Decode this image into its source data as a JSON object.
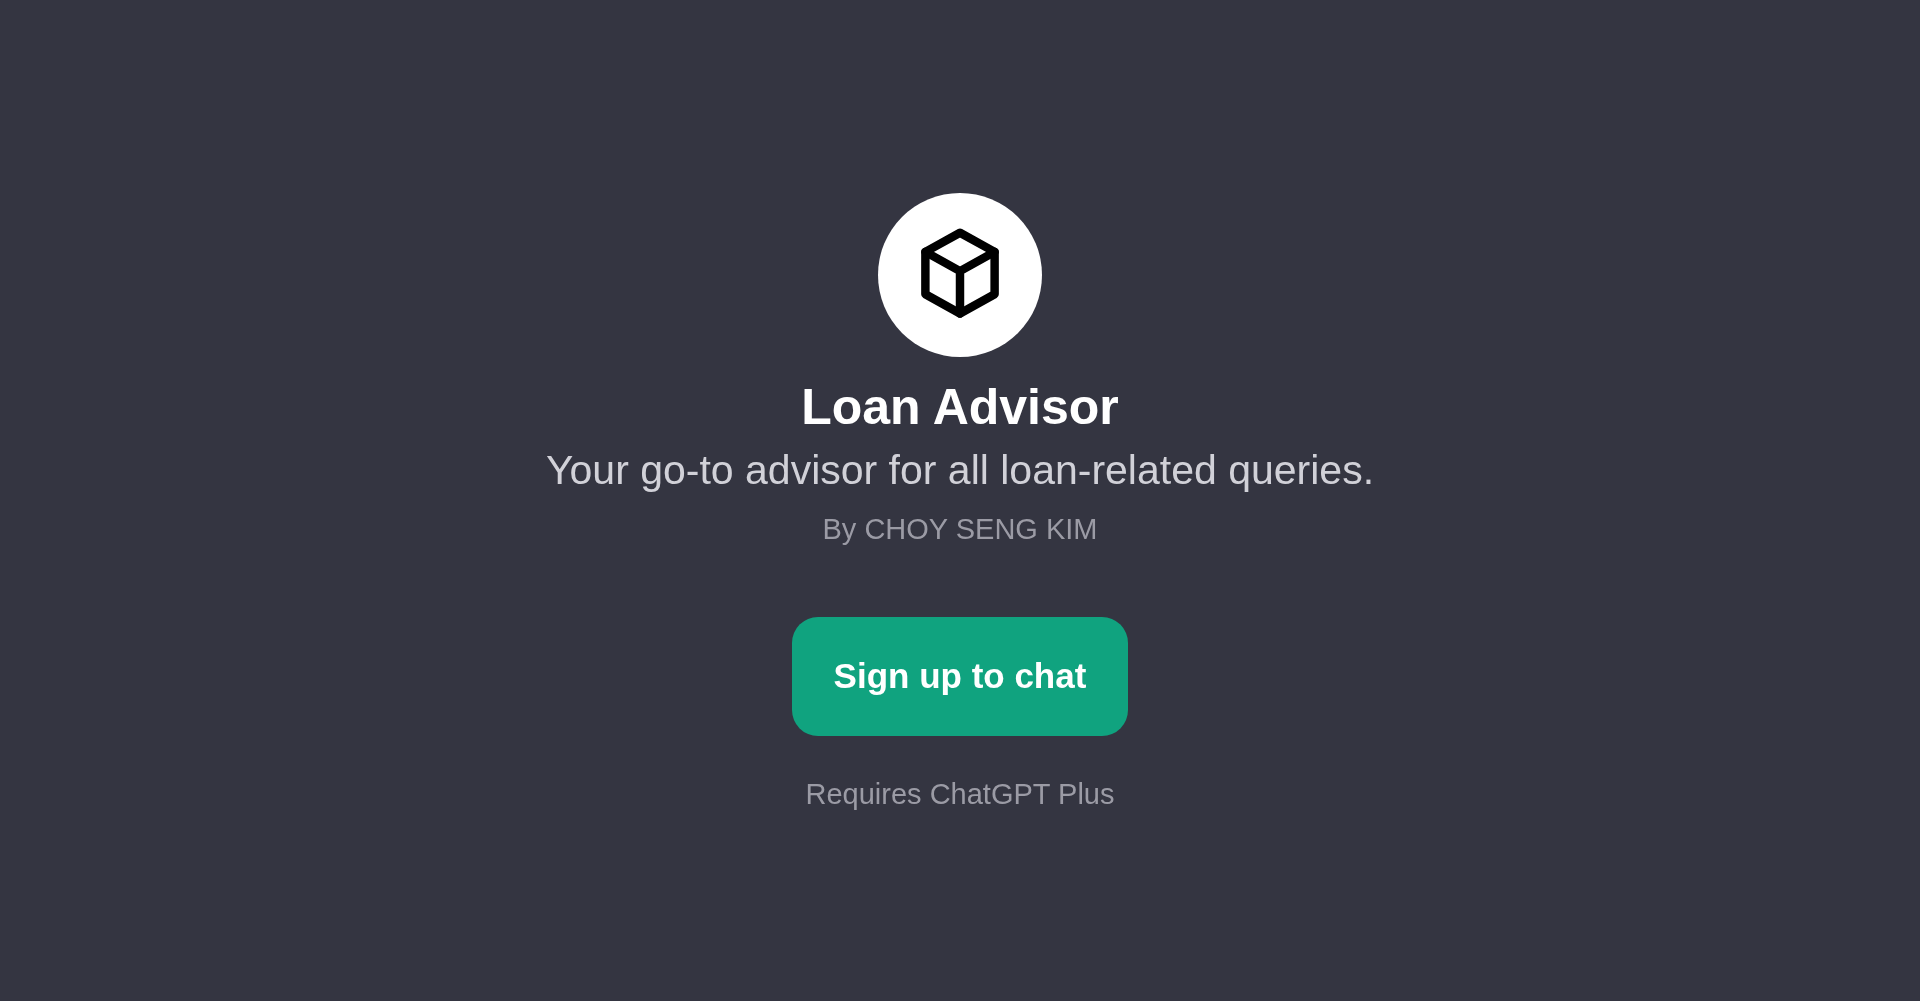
{
  "gpt": {
    "title": "Loan Advisor",
    "description": "Your go-to advisor for all loan-related queries.",
    "author": "By CHOY SENG KIM"
  },
  "cta": {
    "label": "Sign up to chat"
  },
  "note": "Requires ChatGPT Plus"
}
